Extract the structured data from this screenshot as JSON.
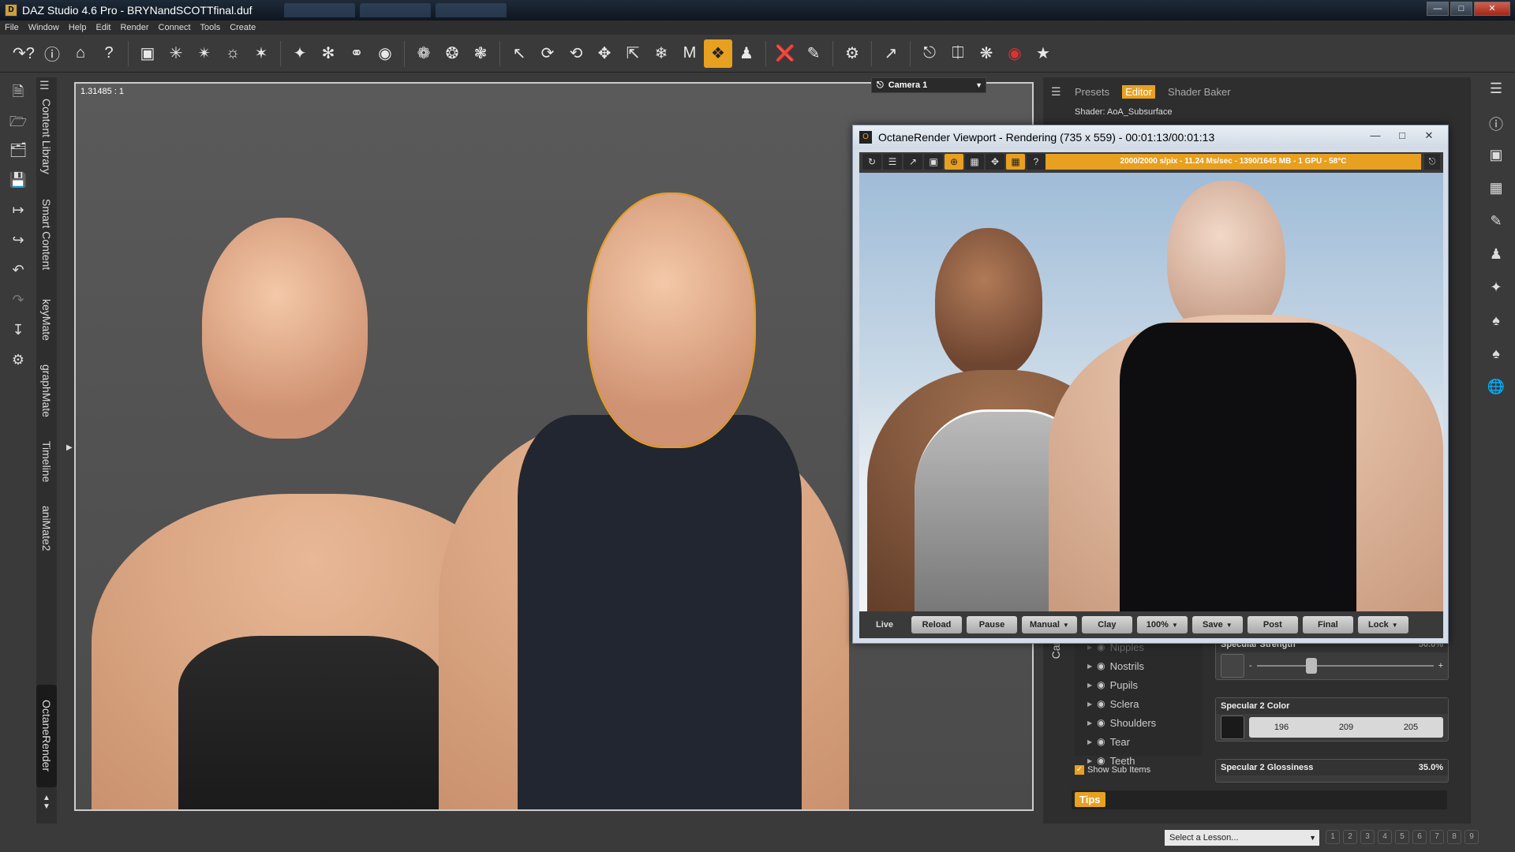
{
  "window": {
    "title": "DAZ Studio 4.6 Pro - BRYNandSCOTTfinal.duf",
    "app_icon": "daz-icon",
    "controls": [
      "minimize",
      "maximize",
      "close"
    ]
  },
  "menu": [
    "File",
    "Window",
    "Help",
    "Edit",
    "Render",
    "Connect",
    "Tools",
    "Create"
  ],
  "toolbar": {
    "icons": [
      "whats-this-icon",
      "help-icon",
      "home-icon",
      "help-circle-icon",
      "scene-icon",
      "point-light-icon",
      "spot-light-icon",
      "distant-light-icon",
      "linear-light-icon",
      "primitive-icon",
      "cube-icon",
      "sphere-icon",
      "cylinder-icon",
      "joint-editor-icon",
      "node-weight-icon",
      "geometry-editor-icon",
      "select-icon",
      "orbit-icon",
      "rotate-icon",
      "translate-icon",
      "scale-icon",
      "universal-icon",
      "morph-icon",
      "active-pose-icon",
      "figure-icon",
      "surface-selection-icon",
      "edit-icon",
      "render-settings-icon",
      "render-icon",
      "pose-icon",
      "camera-icon",
      "camera-setup-icon",
      "iray-icon",
      "record-icon",
      "auto-icon"
    ]
  },
  "left_sidebar": {
    "tabs": [
      "Content Library",
      "Smart Content",
      "keyMate",
      "graphMate",
      "Timeline",
      "aniMate2",
      "OctaneRender"
    ],
    "active_tab": "OctaneRender"
  },
  "viewport": {
    "aspect_label": "1.31485 : 1",
    "camera": "Camera 1"
  },
  "octane": {
    "title": "OctaneRender Viewport - Rendering (735 x 559) - 00:01:13/00:01:13",
    "stats": "2000/2000 s/pix - 11.24 Ms/sec - 1390/1645 MB - 1 GPU - 58°C",
    "buttons": [
      {
        "label": "Live",
        "dropdown": false
      },
      {
        "label": "Reload",
        "dropdown": false
      },
      {
        "label": "Pause",
        "dropdown": false
      },
      {
        "label": "Manual",
        "dropdown": true
      },
      {
        "label": "Clay",
        "dropdown": false
      },
      {
        "label": "100%",
        "dropdown": true
      },
      {
        "label": "Save",
        "dropdown": true
      },
      {
        "label": "Post",
        "dropdown": false
      },
      {
        "label": "Final",
        "dropdown": false
      },
      {
        "label": "Lock",
        "dropdown": true
      }
    ]
  },
  "surfaces_panel": {
    "tabs": [
      "Presets",
      "Editor",
      "Shader Baker"
    ],
    "active_tab": "Editor",
    "shader": "Shader: AoA_Subsurface",
    "side_label": "Came",
    "items": [
      "Nipples",
      "Nostrils",
      "Pupils",
      "Sclera",
      "Shoulders",
      "Tear",
      "Teeth"
    ],
    "show_sub_items": "Show Sub Items",
    "props": {
      "spec_strength": {
        "label": "Specular Strength",
        "value": "50.0%"
      },
      "spec2_color": {
        "label": "Specular 2 Color",
        "r": "196",
        "g": "209",
        "b": "205"
      },
      "spec2_gloss": {
        "label": "Specular 2 Glossiness",
        "value": "35.0%"
      }
    },
    "tips": "Tips"
  },
  "statusbar": {
    "lesson": "Select a Lesson...",
    "pages": [
      "1",
      "2",
      "3",
      "4",
      "5",
      "6",
      "7",
      "8",
      "9"
    ]
  },
  "colors": {
    "accent": "#e8a020",
    "panel_bg": "#2e2e2e",
    "chrome_bg": "#3a3a3a"
  }
}
